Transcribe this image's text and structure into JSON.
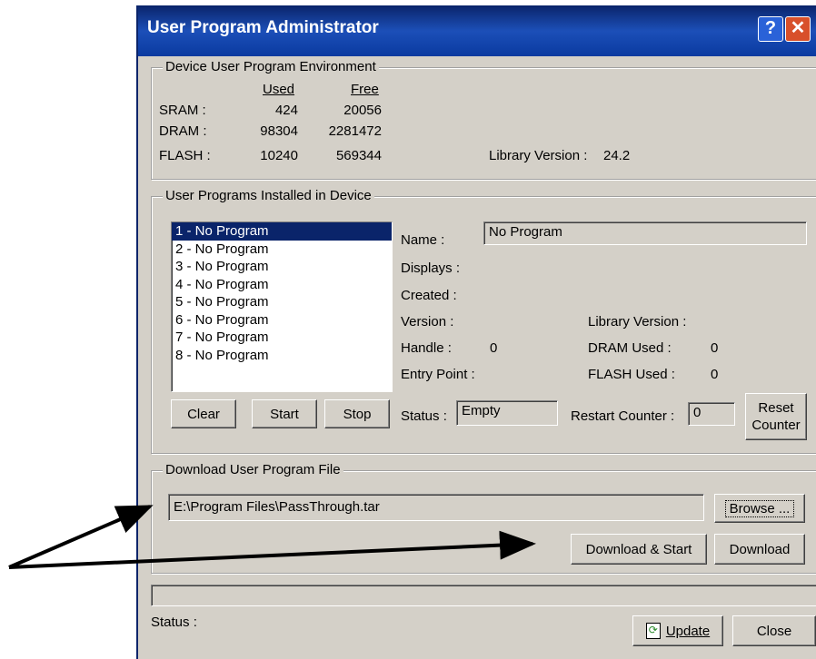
{
  "window": {
    "title": "User Program Administrator",
    "help_glyph": "?",
    "close_glyph": "✕"
  },
  "environment": {
    "group_label": "Device User Program Environment",
    "col_used": "Used",
    "col_free": "Free",
    "rows": [
      {
        "label": "SRAM :",
        "used": "424",
        "free": "20056"
      },
      {
        "label": "DRAM :",
        "used": "98304",
        "free": "2281472"
      },
      {
        "label": "FLASH :",
        "used": "10240",
        "free": "569344"
      }
    ],
    "library_version_label": "Library Version :",
    "library_version_value": "24.2"
  },
  "installed": {
    "group_label": "User Programs Installed in Device",
    "programs": [
      "1 - No Program",
      "2 - No Program",
      "3 - No Program",
      "4 - No Program",
      "5 - No Program",
      "6 - No Program",
      "7 - No Program",
      "8 - No Program"
    ],
    "selected_index": 0,
    "name_label": "Name :",
    "name_value": "No Program",
    "displays_label": "Displays :",
    "created_label": "Created :",
    "version_label": "Version :",
    "handle_label": "Handle :",
    "handle_value": "0",
    "entry_point_label": "Entry Point :",
    "library_version_label": "Library Version :",
    "dram_used_label": "DRAM Used :",
    "dram_used_value": "0",
    "flash_used_label": "FLASH Used :",
    "flash_used_value": "0",
    "status_label": "Status :",
    "status_value": "Empty",
    "restart_counter_label": "Restart Counter :",
    "restart_counter_value": "0",
    "clear_button": "Clear",
    "start_button": "Start",
    "stop_button": "Stop",
    "reset_counter_line1": "Reset",
    "reset_counter_line2": "Counter"
  },
  "download": {
    "group_label": "Download User Program File",
    "file_path": "E:\\Program Files\\PassThrough.tar",
    "browse_button": "Browse ...",
    "download_start_button": "Download & Start",
    "download_button": "Download"
  },
  "footer": {
    "status_label": "Status :",
    "update_button": "Update",
    "close_button": "Close"
  },
  "colors": {
    "title_bar": "#0a246a",
    "dialog_face": "#d4d0c8",
    "selection": "#0a246a"
  }
}
